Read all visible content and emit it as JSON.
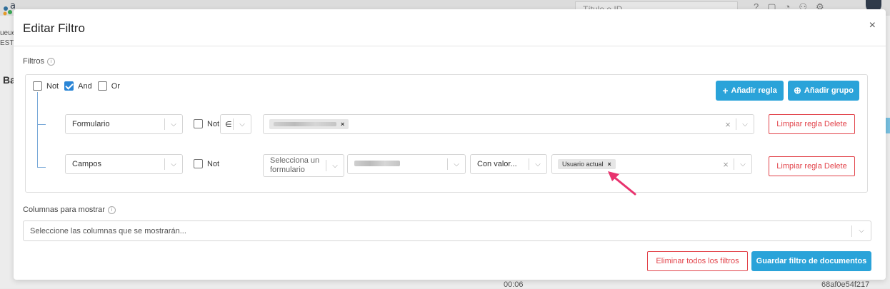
{
  "background": {
    "left_text_1": "ueue",
    "left_text_2": "EST-E",
    "left_title": "Ba",
    "search_placeholder": "Título o ID",
    "bottom_time": "00:06",
    "bottom_id": "68af0e54f217"
  },
  "modal": {
    "title": "Editar Filtro",
    "close": "×"
  },
  "filters": {
    "section_label": "Filtros",
    "conditions": [
      {
        "label": "Not",
        "checked": false
      },
      {
        "label": "And",
        "checked": true
      },
      {
        "label": "Or",
        "checked": false
      }
    ],
    "add_rule": "Añadir regla",
    "add_group": "Añadir grupo",
    "rules": [
      {
        "field": "Formulario",
        "not_label": "Not",
        "operator": "∈",
        "value_tag_x": "×",
        "clear_label": "Limpiar regla Delete"
      },
      {
        "field": "Campos",
        "not_label": "Not",
        "form_placeholder": "Selecciona un formulario",
        "condition": "Con valor...",
        "value_tag": "Usuario actual",
        "value_tag_x": "×",
        "clear_label": "Limpiar regla Delete"
      }
    ]
  },
  "columns": {
    "section_label": "Columnas para mostrar",
    "placeholder": "Seleccione las columnas que se mostrarán..."
  },
  "footer": {
    "remove_all": "Eliminar todos los filtros",
    "save": "Guardar filtro de documentos"
  },
  "colors": {
    "primary": "#2aa3d9",
    "danger": "#e2434a",
    "checkbox_checked": "#2a85d6",
    "arrow": "#e8336e"
  }
}
